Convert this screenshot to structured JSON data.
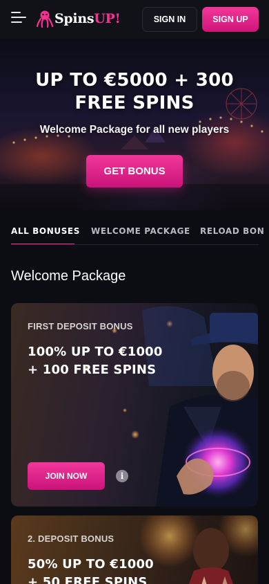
{
  "header": {
    "logo_prefix": "Spins",
    "logo_suffix": "UP!",
    "signin_label": "SIGN IN",
    "signup_label": "SIGN UP"
  },
  "hero": {
    "title_line1": "UP TO €5000 + 300",
    "title_line2": "FREE SPINS",
    "subtitle": "Welcome Package for all new players",
    "cta_label": "GET BONUS"
  },
  "tabs": [
    {
      "label": "ALL BONUSES",
      "active": true
    },
    {
      "label": "WELCOME PACKAGE",
      "active": false
    },
    {
      "label": "RELOAD BON",
      "active": false
    }
  ],
  "section_title": "Welcome Package",
  "cards": [
    {
      "label": "FIRST DEPOSIT BONUS",
      "title_line1": "100% UP TO €1000",
      "title_line2": "+ 100 FREE SPINS",
      "cta_label": "JOIN NOW",
      "info_icon": "i"
    },
    {
      "label": "2. DEPOSIT BONUS",
      "title_line1": "50% UP TO €1000",
      "title_line2": "+ 50 FREE SPINS"
    }
  ],
  "colors": {
    "accent": "#ff2e93",
    "background": "#0c0d12",
    "header": "#111218"
  },
  "icons": {
    "menu": "hamburger-menu-icon",
    "logo": "octopus-logo-icon",
    "info": "info-icon"
  }
}
